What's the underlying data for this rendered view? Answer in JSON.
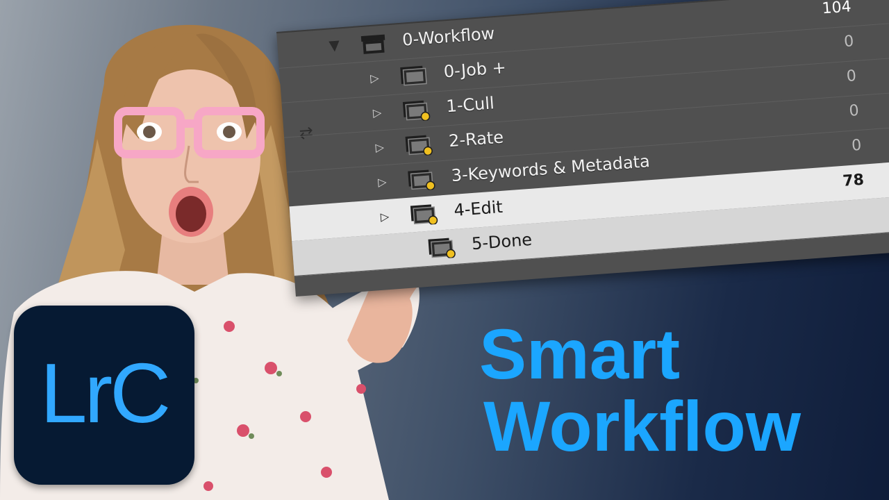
{
  "panel": {
    "side_icon": "swap-arrows-icon",
    "rows": [
      {
        "label": "0-Workflow",
        "count": "104",
        "kind": "collection-set",
        "expanded": true
      },
      {
        "label": "0-Job  +",
        "count": "0",
        "kind": "collection"
      },
      {
        "label": "1-Cull",
        "count": "0",
        "kind": "smart-collection"
      },
      {
        "label": "2-Rate",
        "count": "0",
        "kind": "smart-collection"
      },
      {
        "label": "3-Keywords & Metadata",
        "count": "0",
        "kind": "smart-collection"
      },
      {
        "label": "4-Edit",
        "count": "78",
        "kind": "smart-collection",
        "selected": true
      },
      {
        "label": "5-Done",
        "count": "",
        "kind": "smart-collection",
        "selected": true
      }
    ]
  },
  "badge": {
    "text": "LrC",
    "bg": "#061a33",
    "fg": "#31a8ff"
  },
  "title": {
    "line1": "Smart",
    "line2": "Workflow",
    "color": "#1ba6ff"
  }
}
